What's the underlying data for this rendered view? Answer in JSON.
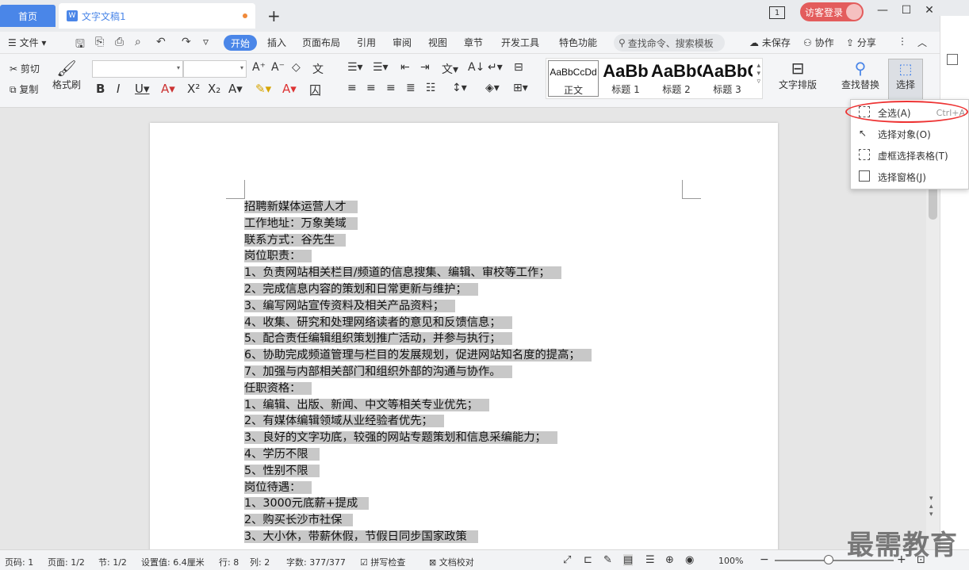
{
  "tabs": {
    "home": "首页",
    "doc": "文字文稿1",
    "new": "+"
  },
  "titlebar": {
    "login": "访客登录",
    "page_ind": "1"
  },
  "menu": {
    "file": "文件",
    "items": [
      "开始",
      "插入",
      "页面布局",
      "引用",
      "审阅",
      "视图",
      "章节",
      "开发工具",
      "特色功能"
    ],
    "search": "查找命令、搜索模板",
    "unsaved": "未保存",
    "collab": "协作",
    "share": "分享"
  },
  "ribbon": {
    "cut": "剪切",
    "copy": "复制",
    "format_painter": "格式刷",
    "styles": [
      {
        "sample": "AaBbCcDd",
        "label": "正文"
      },
      {
        "sample": "AaBb",
        "label": "标题 1"
      },
      {
        "sample": "AaBbC",
        "label": "标题 2"
      },
      {
        "sample": "AaBbC",
        "label": "标题 3"
      }
    ],
    "text_layout": "文字排版",
    "find_replace": "查找替换",
    "select": "选择"
  },
  "dropdown": {
    "items": [
      {
        "label": "全选(A)",
        "shortcut": "Ctrl+A"
      },
      {
        "label": "选择对象(O)",
        "shortcut": ""
      },
      {
        "label": "虚框选择表格(T)",
        "shortcut": ""
      },
      {
        "label": "选择窗格(J)",
        "shortcut": ""
      }
    ]
  },
  "document": {
    "lines": [
      "招聘新媒体运营人才",
      "工作地址：万象美域",
      "联系方式：谷先生",
      "岗位职责：",
      "1、负责网站相关栏目/频道的信息搜集、编辑、审校等工作；",
      "2、完成信息内容的策划和日常更新与维护；",
      "3、编写网站宣传资料及相关产品资料；",
      "4、收集、研究和处理网络读者的意见和反馈信息；",
      "5、配合责任编辑组织策划推广活动，并参与执行；",
      "6、协助完成频道管理与栏目的发展规划，促进网站知名度的提高；",
      "7、加强与内部相关部门和组织外部的沟通与协作。",
      "任职资格：",
      "1、编辑、出版、新闻、中文等相关专业优先；",
      "2、有媒体编辑领域从业经验者优先；",
      "3、良好的文字功底，较强的网站专题策划和信息采编能力；",
      "4、学历不限",
      "5、性别不限",
      "岗位待遇：",
      "1、3000元底薪+提成",
      "2、购买长沙市社保",
      "3、大小休，带薪休假，节假日同步国家政策"
    ]
  },
  "status": {
    "page_num": "页码: 1",
    "page": "页面: 1/2",
    "section": "节: 1/2",
    "setting": "设置值: 6.4厘米",
    "row": "行: 8",
    "col": "列: 2",
    "words": "字数: 377/377",
    "spell": "拼写检查",
    "proof": "文档校对",
    "zoom": "100%",
    "zoom_level": 0.45
  },
  "watermark": "最需教育"
}
